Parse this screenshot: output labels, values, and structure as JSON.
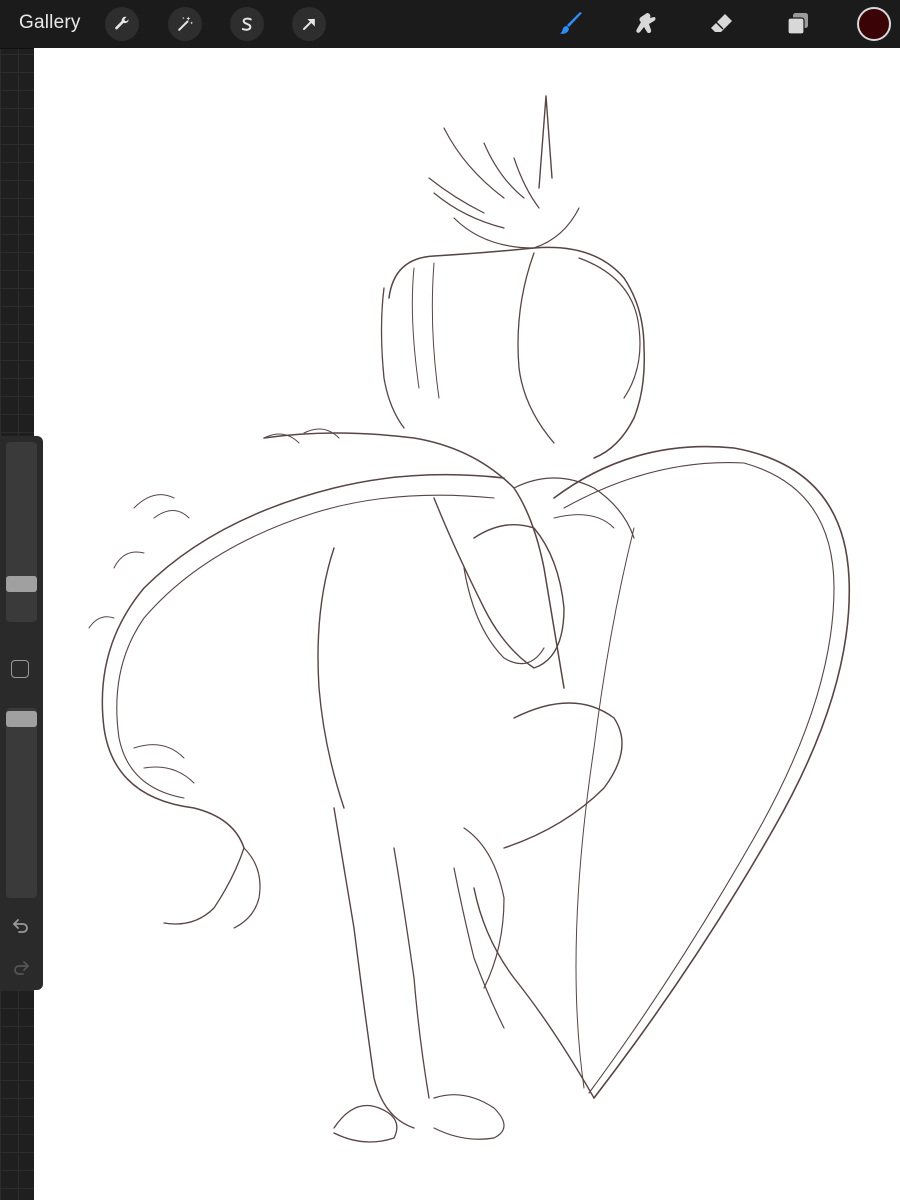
{
  "topbar": {
    "gallery_label": "Gallery",
    "left_tools": [
      {
        "name": "actions-wrench-icon"
      },
      {
        "name": "adjustments-wand-icon"
      },
      {
        "name": "selection-s-icon"
      },
      {
        "name": "transform-arrow-icon"
      }
    ],
    "right_tools": [
      {
        "name": "brush-icon",
        "active": true,
        "color": "#2f8cf6"
      },
      {
        "name": "smudge-icon",
        "active": false
      },
      {
        "name": "eraser-icon",
        "active": false
      },
      {
        "name": "layers-icon",
        "active": false
      }
    ],
    "current_color": "#3a0306"
  },
  "sidebar": {
    "brush_size_slider": 0.18,
    "opacity_slider": 0.98
  },
  "canvas": {
    "background": "#ffffff",
    "stroke_color": "#3b2424"
  }
}
